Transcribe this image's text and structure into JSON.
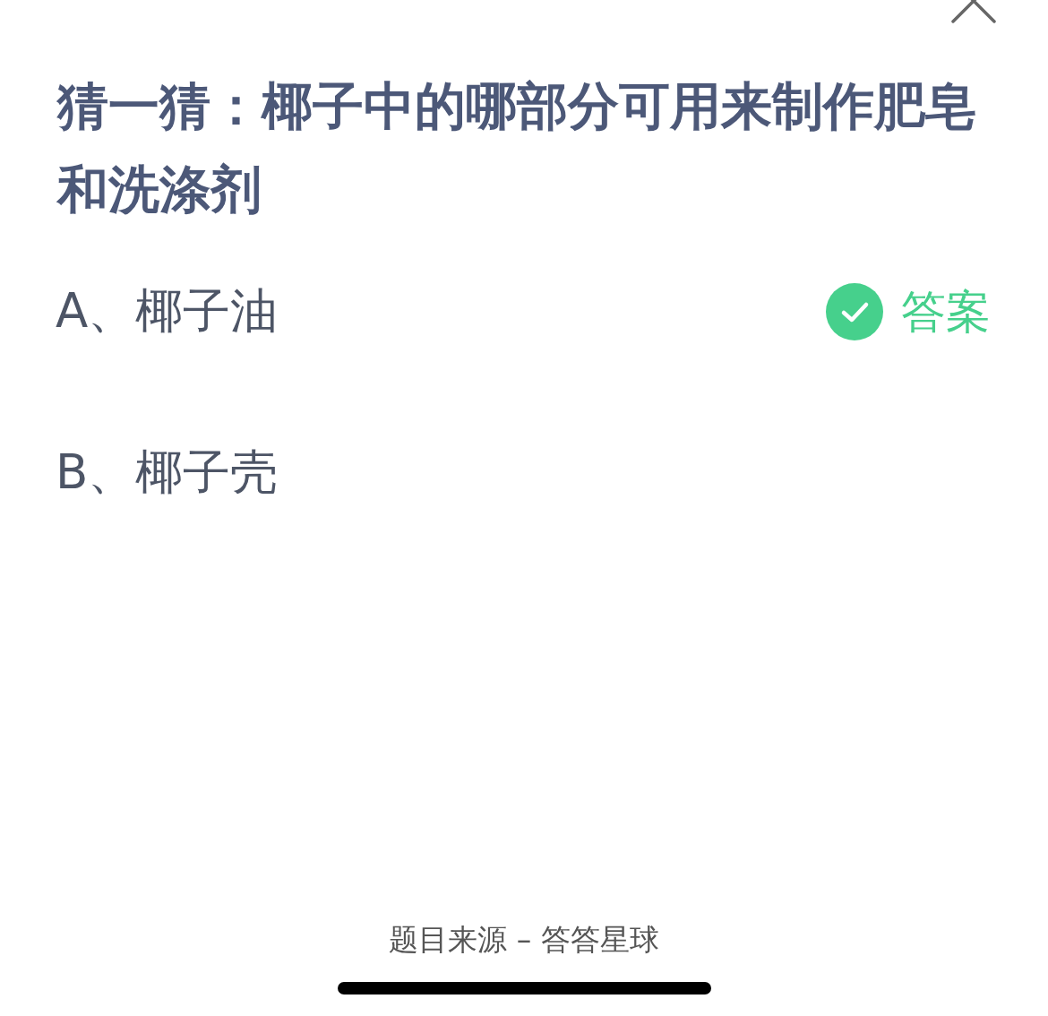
{
  "title": "猜一猜：椰子中的哪部分可用来制作肥皂和洗涤剂",
  "answer_badge": "答案",
  "options": [
    {
      "label": "A、椰子油",
      "correct": true
    },
    {
      "label": "B、椰子壳",
      "correct": false
    }
  ],
  "footer": "题目来源 – 答答星球"
}
